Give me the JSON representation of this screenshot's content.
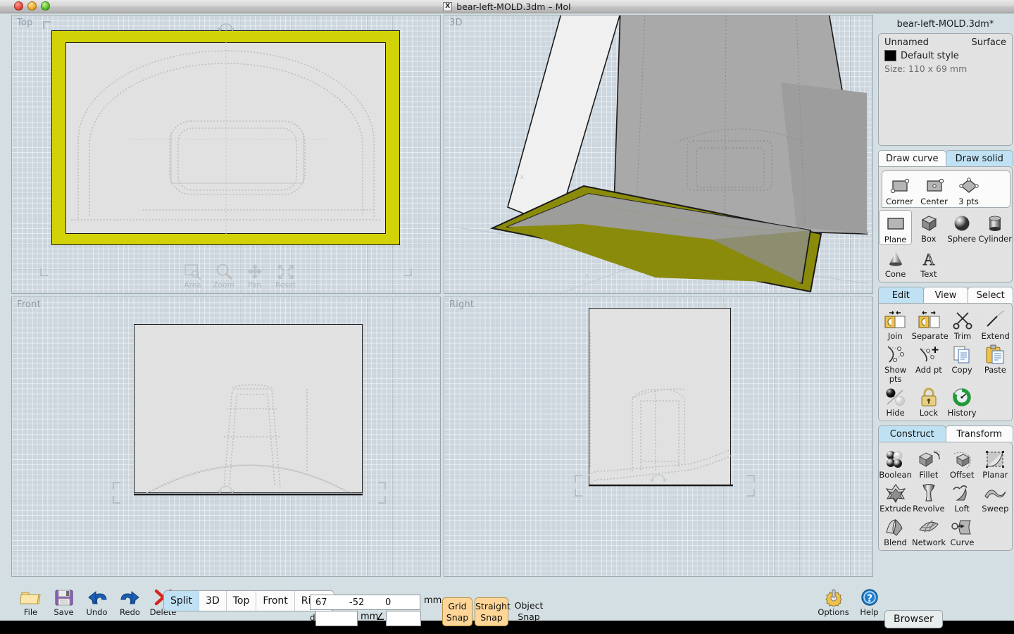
{
  "window": {
    "title": "bear-left-MOLD.3dm – MoI",
    "file_icon": "X",
    "close_label": "close",
    "minimize_label": "minimize",
    "maximize_label": "maximize"
  },
  "viewports": [
    {
      "id": "top",
      "label": "Top"
    },
    {
      "id": "3d",
      "label": "3D"
    },
    {
      "id": "front",
      "label": "Front"
    },
    {
      "id": "right",
      "label": "Right"
    }
  ],
  "nav_controls": [
    {
      "name": "area",
      "label": "Area"
    },
    {
      "name": "zoom",
      "label": "Zoom"
    },
    {
      "name": "pan",
      "label": "Pan"
    },
    {
      "name": "reset",
      "label": "Reset"
    }
  ],
  "properties": {
    "document_title": "bear-left-MOLD.3dm*",
    "object_name": "Unnamed",
    "object_type": "Surface",
    "style_name": "Default style",
    "style_color": "#000000",
    "size_text": "Size: 110 x 69 mm"
  },
  "draw_palette": {
    "tabs": [
      {
        "label": "Draw curve",
        "active": false
      },
      {
        "label": "Draw solid",
        "active": true
      }
    ],
    "sub_items": [
      {
        "label": "Corner",
        "icon": "rect-corner-icon"
      },
      {
        "label": "Center",
        "icon": "rect-center-icon"
      },
      {
        "label": "3 pts",
        "icon": "rect-3pts-icon"
      }
    ],
    "items": [
      {
        "label": "Plane",
        "icon": "plane-icon",
        "selected": true
      },
      {
        "label": "Box",
        "icon": "box-icon",
        "selected": false
      },
      {
        "label": "Sphere",
        "icon": "sphere-icon",
        "selected": false
      },
      {
        "label": "Cylinder",
        "icon": "cylinder-icon",
        "selected": false
      },
      {
        "label": "Cone",
        "icon": "cone-icon",
        "selected": false
      },
      {
        "label": "Text",
        "icon": "text-icon",
        "selected": false
      }
    ]
  },
  "edit_palette": {
    "tabs": [
      {
        "label": "Edit",
        "active": true
      },
      {
        "label": "View",
        "active": false
      },
      {
        "label": "Select",
        "active": false
      }
    ],
    "items": [
      {
        "label": "Join",
        "icon": "join-icon"
      },
      {
        "label": "Separate",
        "icon": "separate-icon"
      },
      {
        "label": "Trim",
        "icon": "scissors-icon"
      },
      {
        "label": "Extend",
        "icon": "extend-icon"
      },
      {
        "label": "Show pts",
        "icon": "show-points-icon"
      },
      {
        "label": "Add pt",
        "icon": "add-point-icon"
      },
      {
        "label": "Copy",
        "icon": "copy-icon"
      },
      {
        "label": "Paste",
        "icon": "paste-icon"
      },
      {
        "label": "Hide",
        "icon": "hide-icon"
      },
      {
        "label": "Lock",
        "icon": "lock-icon"
      },
      {
        "label": "History",
        "icon": "history-icon"
      }
    ]
  },
  "construct_palette": {
    "tabs": [
      {
        "label": "Construct",
        "active": true
      },
      {
        "label": "Transform",
        "active": false
      }
    ],
    "items": [
      {
        "label": "Boolean",
        "icon": "boolean-icon"
      },
      {
        "label": "Fillet",
        "icon": "fillet-icon"
      },
      {
        "label": "Offset",
        "icon": "offset-icon"
      },
      {
        "label": "Planar",
        "icon": "planar-icon"
      },
      {
        "label": "Extrude",
        "icon": "extrude-icon"
      },
      {
        "label": "Revolve",
        "icon": "revolve-icon"
      },
      {
        "label": "Loft",
        "icon": "loft-icon"
      },
      {
        "label": "Sweep",
        "icon": "sweep-icon"
      },
      {
        "label": "Blend",
        "icon": "blend-icon"
      },
      {
        "label": "Network",
        "icon": "network-icon"
      },
      {
        "label": "Curve",
        "icon": "curve-icon"
      }
    ]
  },
  "bottom_bar": {
    "buttons": [
      {
        "label": "File",
        "icon": "folder-icon"
      },
      {
        "label": "Save",
        "icon": "floppy-icon"
      },
      {
        "label": "Undo",
        "icon": "undo-arrow-icon"
      },
      {
        "label": "Redo",
        "icon": "redo-arrow-icon"
      },
      {
        "label": "Delete",
        "icon": "delete-x-icon"
      }
    ],
    "view_modes": [
      {
        "label": "Split",
        "active": true
      },
      {
        "label": "3D",
        "active": false
      },
      {
        "label": "Top",
        "active": false
      },
      {
        "label": "Front",
        "active": false
      },
      {
        "label": "Right",
        "active": false
      }
    ],
    "coords": {
      "x": "67",
      "y": "-52",
      "z": "0",
      "unit": "mm"
    },
    "distance": {
      "prefix": "d",
      "value": "",
      "unit": "mm",
      "angle_symbol": "∠",
      "angle_value": ""
    },
    "snaps": [
      {
        "label_line1": "Grid",
        "label_line2": "Snap",
        "active": true
      },
      {
        "label_line1": "Straight",
        "label_line2": "Snap",
        "active": true
      },
      {
        "label_line1": "Object",
        "label_line2": "Snap",
        "active": false
      }
    ],
    "right_buttons": [
      {
        "label": "Options",
        "icon": "gear-icon"
      },
      {
        "label": "Help",
        "icon": "help-icon"
      }
    ],
    "browser_label": "Browser"
  },
  "colors": {
    "selection_yellow": "#d2d208",
    "selection_yellow_dark": "#8a8a0b",
    "viewport_bg": "#ccd6de",
    "paper": "#e1e1e1",
    "panel_bg": "#e2e2e2",
    "tab_active": "#bfe1f3",
    "snap_active": "#ffd697",
    "chrome": "#d3dfe2"
  }
}
